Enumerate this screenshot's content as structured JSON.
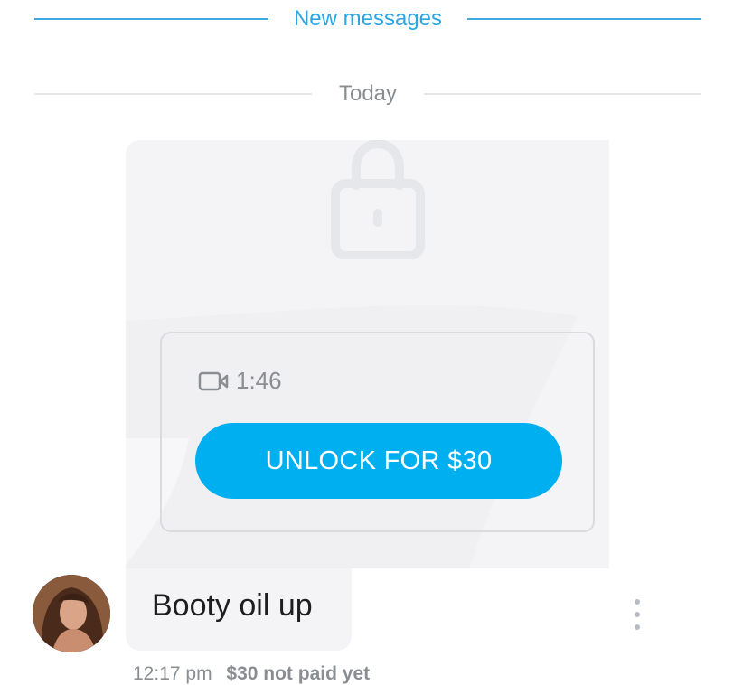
{
  "dividers": {
    "new_messages": "New messages",
    "today": "Today"
  },
  "locked_media": {
    "media_icon": "video-camera-icon",
    "lock_icon": "padlock-icon",
    "duration": "1:46",
    "unlock_label": "UNLOCK FOR $30"
  },
  "message": {
    "text": "Booty oil up",
    "time": "12:17 pm",
    "price_status": "$30 not paid yet",
    "options_icon": "vertical-dots-icon"
  },
  "colors": {
    "accent": "#00aff0",
    "divider_new": "#40a9e0",
    "bubble_bg": "#f4f4f6",
    "muted_text": "#8a8d91"
  }
}
